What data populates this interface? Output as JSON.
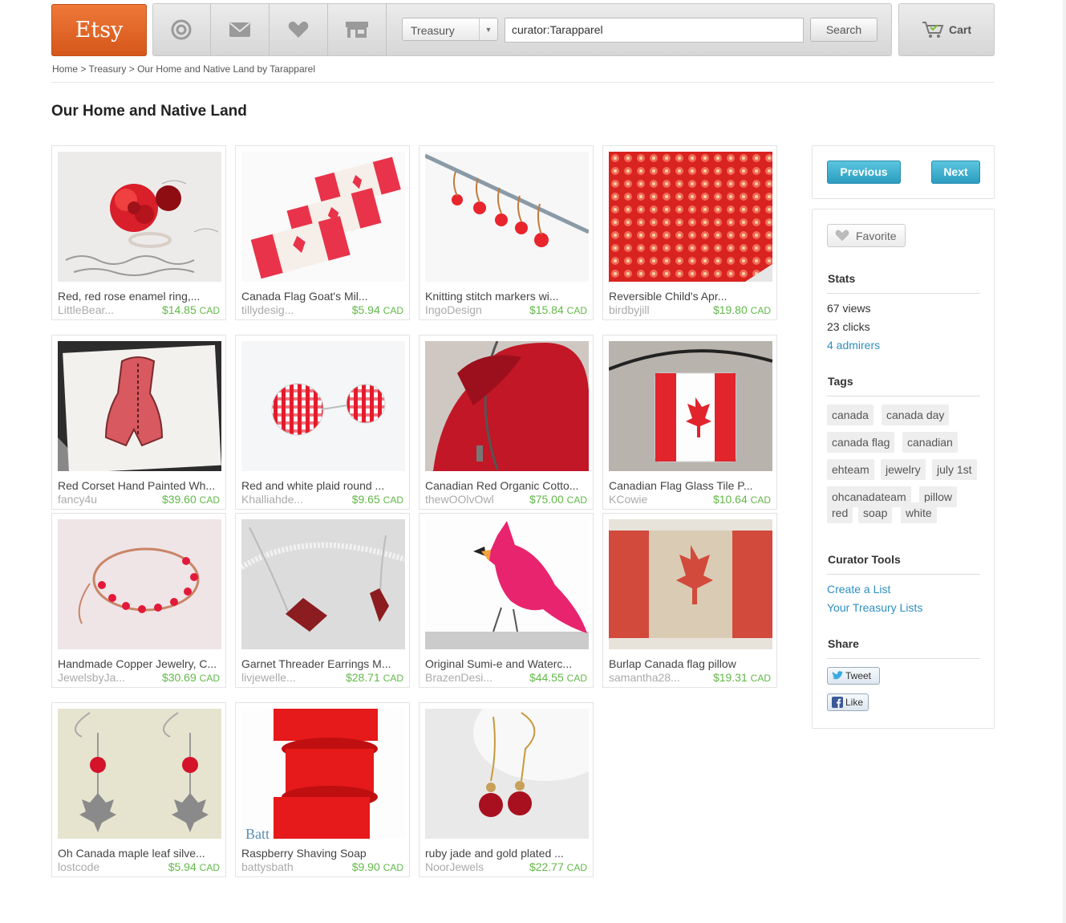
{
  "header": {
    "logo": "Etsy",
    "nav_icons": [
      "target-icon",
      "mail-icon",
      "heart-icon",
      "shop-icon"
    ],
    "search_category": "Treasury",
    "search_value": "curator:Tarapparel",
    "search_button": "Search",
    "cart_label": "Cart"
  },
  "breadcrumb": {
    "home": "Home",
    "sep1": " > ",
    "treasury": "Treasury",
    "sep2": " > ",
    "current": "Our Home and Native Land by Tarapparel"
  },
  "page_title": "Our Home and Native Land",
  "items": [
    {
      "title": "Red, red rose enamel ring,...",
      "shop": "LittleBear...",
      "price": "$14.85",
      "currency": "CAD"
    },
    {
      "title": "Canada Flag Goat's Mil...",
      "shop": "tillydesig...",
      "price": "$5.94",
      "currency": "CAD"
    },
    {
      "title": "Knitting stitch markers wi...",
      "shop": "IngoDesign",
      "price": "$15.84",
      "currency": "CAD"
    },
    {
      "title": "Reversible Child's Apr...",
      "shop": "birdbyjill",
      "price": "$19.80",
      "currency": "CAD"
    },
    {
      "title": "Red Corset Hand Painted Wh...",
      "shop": "fancy4u",
      "price": "$39.60",
      "currency": "CAD"
    },
    {
      "title": "Red and white plaid round ...",
      "shop": "Khalliahde...",
      "price": "$9.65",
      "currency": "CAD"
    },
    {
      "title": "Canadian Red Organic Cotto...",
      "shop": "thewOOlvOwl",
      "price": "$75.00",
      "currency": "CAD"
    },
    {
      "title": "Canadian Flag Glass Tile P...",
      "shop": "KCowie",
      "price": "$10.64",
      "currency": "CAD"
    },
    {
      "title": "Handmade Copper Jewelry, C...",
      "shop": "JewelsbyJa...",
      "price": "$30.69",
      "currency": "CAD"
    },
    {
      "title": "Garnet Threader Earrings M...",
      "shop": "livjewelle...",
      "price": "$28.71",
      "currency": "CAD"
    },
    {
      "title": "Original Sumi-e and Waterc...",
      "shop": "BrazenDesi...",
      "price": "$44.55",
      "currency": "CAD"
    },
    {
      "title": "Burlap Canada flag pillow",
      "shop": "samantha28...",
      "price": "$19.31",
      "currency": "CAD"
    },
    {
      "title": "Oh Canada maple leaf silve...",
      "shop": "lostcode",
      "price": "$5.94",
      "currency": "CAD"
    },
    {
      "title": "Raspberry Shaving Soap",
      "shop": "battysbath",
      "price": "$9.90",
      "currency": "CAD"
    },
    {
      "title": "ruby jade and gold plated ...",
      "shop": "NoorJewels",
      "price": "$22.77",
      "currency": "CAD"
    }
  ],
  "sidebar": {
    "previous": "Previous",
    "next": "Next",
    "favorite": "Favorite",
    "stats_heading": "Stats",
    "views": "67 views",
    "clicks": "23 clicks",
    "admirers": "4 admirers",
    "tags_heading": "Tags",
    "tags": [
      "canada",
      "canada day",
      "canada flag",
      "canadian",
      "ehteam",
      "jewelry",
      "july 1st",
      "ohcanadateam",
      "pillow",
      "red",
      "soap",
      "white"
    ],
    "curator_heading": "Curator Tools",
    "create_list": "Create a List",
    "your_lists": "Your Treasury Lists",
    "share_heading": "Share",
    "tweet": "Tweet",
    "like": "Like"
  },
  "colors": {
    "brand_orange": "#e0662a",
    "price_green": "#62b849",
    "link_blue": "#2d8fbf",
    "button_blue": "#3aaed0"
  }
}
